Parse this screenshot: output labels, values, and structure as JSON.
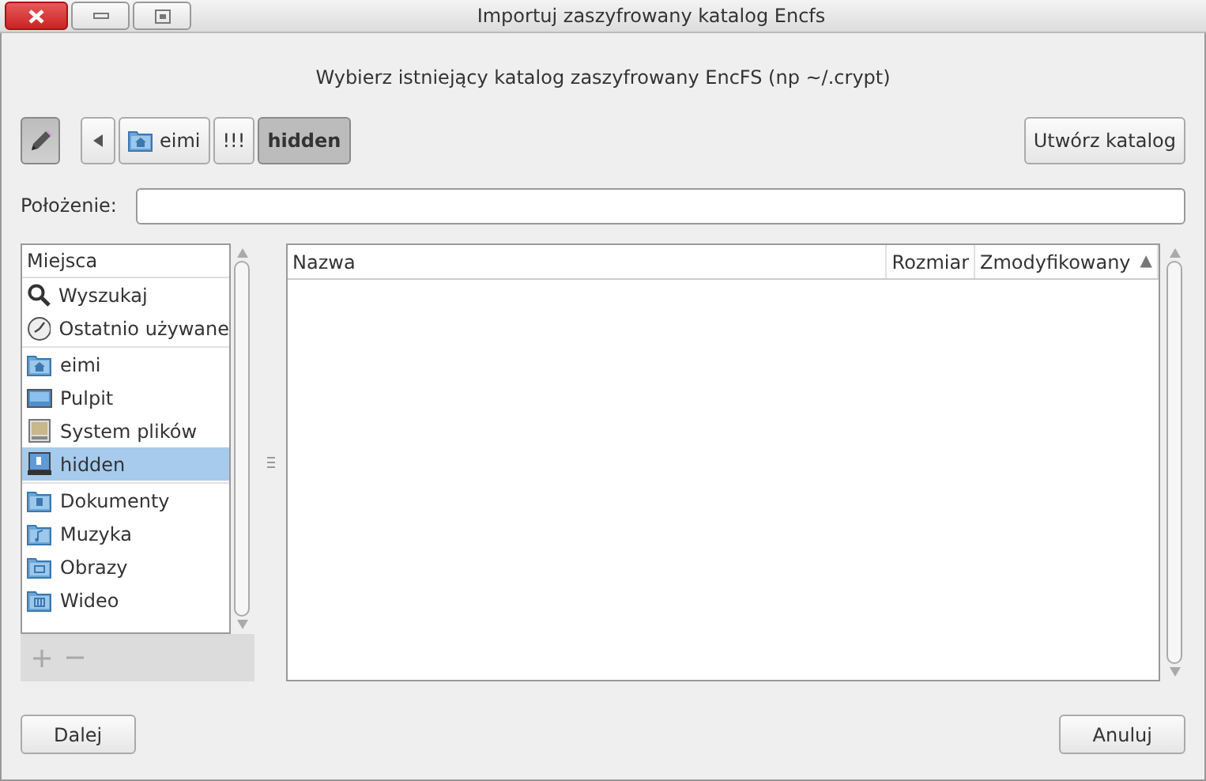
{
  "window": {
    "title": "Importuj zaszyfrowany katalog Encfs"
  },
  "prompt": "Wybierz istniejący katalog zaszyfrowany EncFS (np ~/.crypt)",
  "path_bar": {
    "edit_toggle": {
      "on": true
    },
    "crumbs": [
      {
        "label": "eimi",
        "kind": "home",
        "selected": false
      },
      {
        "label": "!!!",
        "kind": "plain",
        "selected": false
      },
      {
        "label": "hidden",
        "kind": "plain",
        "selected": true
      }
    ]
  },
  "create_folder_button": "Utwórz katalog",
  "location": {
    "label": "Położenie:"
  },
  "sidebar": {
    "heading": "Miejsca",
    "sections": [
      [
        {
          "label": "Wyszukaj",
          "kind": "search",
          "selected": false
        },
        {
          "label": "Ostatnio używane",
          "kind": "recent",
          "selected": false
        }
      ],
      [
        {
          "label": "eimi",
          "kind": "home",
          "selected": false
        },
        {
          "label": "Pulpit",
          "kind": "desktop",
          "selected": false
        },
        {
          "label": "System plików",
          "kind": "drive",
          "selected": false
        },
        {
          "label": "hidden",
          "kind": "disk",
          "selected": true
        }
      ],
      [
        {
          "label": "Dokumenty",
          "kind": "documents",
          "selected": false
        },
        {
          "label": "Muzyka",
          "kind": "music",
          "selected": false
        },
        {
          "label": "Obrazy",
          "kind": "pictures",
          "selected": false
        },
        {
          "label": "Wideo",
          "kind": "video",
          "selected": false
        }
      ]
    ],
    "add_button": {
      "disabled": true
    },
    "remove_button": {
      "disabled": true
    }
  },
  "files": {
    "columns": [
      {
        "label": "Nazwa"
      },
      {
        "label": "Rozmiar"
      },
      {
        "label": "Zmodyfikowany",
        "sort": "▲"
      }
    ]
  },
  "buttons": {
    "next": "Dalej",
    "cancel": "Anuluj"
  }
}
